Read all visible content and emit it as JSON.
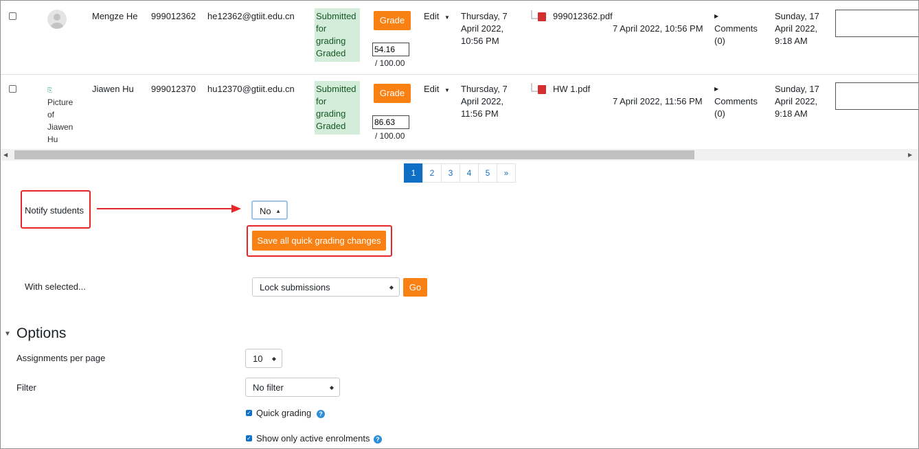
{
  "rows": [
    {
      "name": "Mengze He",
      "id_number": "999012362",
      "email": "he12362@gtiit.edu.cn",
      "status": [
        "Submitted",
        "for",
        "grading",
        "Graded"
      ],
      "grade_button": "Grade",
      "grade_value": "54.16",
      "grade_max": "/ 100.00",
      "edit_label": "Edit",
      "modified": [
        "Thursday, 7",
        "April 2022,",
        "10:56 PM"
      ],
      "file_name": "999012362.pdf",
      "file_time": "7 April 2022, 10:56 PM",
      "comments": [
        "Comments",
        "(0)"
      ],
      "last_modified": [
        "Sunday, 17",
        "April 2022,",
        "9:18 AM"
      ]
    },
    {
      "name": "Jiawen Hu",
      "id_number": "999012370",
      "email": "hu12370@gtiit.edu.cn",
      "status": [
        "Submitted",
        "for",
        "grading",
        "Graded"
      ],
      "grade_button": "Grade",
      "grade_value": "86.63",
      "grade_max": "/ 100.00",
      "edit_label": "Edit",
      "modified": [
        "Thursday, 7",
        "April 2022,",
        "11:56 PM"
      ],
      "file_name": "HW 1.pdf",
      "file_time": "7 April 2022, 11:56 PM",
      "comments": [
        "Comments",
        "(0)"
      ],
      "last_modified": [
        "Sunday, 17",
        "April 2022,",
        "9:18 AM"
      ],
      "avatar_alt": [
        "Picture",
        "of",
        "Jiawen",
        "Hu"
      ]
    }
  ],
  "pagination": [
    "1",
    "2",
    "3",
    "4",
    "5",
    "»"
  ],
  "notify": {
    "label": "Notify students",
    "value": "No"
  },
  "save_button": "Save all quick grading changes",
  "with_selected": {
    "label": "With selected...",
    "value": "Lock submissions",
    "go": "Go"
  },
  "options": {
    "title": "Options",
    "per_page_label": "Assignments per page",
    "per_page_value": "10",
    "filter_label": "Filter",
    "filter_value": "No filter",
    "quick_grading": "Quick grading",
    "active_enrolments": "Show only active enrolments"
  },
  "colors": {
    "accent": "#f98012",
    "link": "#0f6fc5",
    "annotation": "#e52727",
    "status_bg": "#d4edda"
  }
}
